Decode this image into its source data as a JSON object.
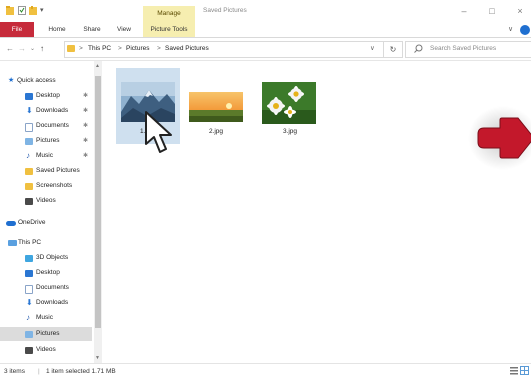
{
  "window": {
    "title": "Saved Pictures",
    "context_tab_group": "Manage",
    "minimize": "–",
    "maximize": "□",
    "close": "×"
  },
  "ribbon": {
    "tabs": [
      "File",
      "Home",
      "Share",
      "View",
      "Picture Tools"
    ],
    "collapse_glyph": "∨"
  },
  "nav": {
    "back": "←",
    "forward": "→",
    "recent": "⌄",
    "up": "↑",
    "breadcrumb": [
      "This PC",
      "Pictures",
      "Saved Pictures"
    ],
    "separator": ">",
    "dropdown": "∨",
    "refresh": "↻",
    "search_placeholder": "Search Saved Pictures"
  },
  "sidebar": {
    "quick_access": "Quick access",
    "quick_items": [
      {
        "label": "Desktop",
        "icon": "desktop-icon",
        "pinned": true
      },
      {
        "label": "Downloads",
        "icon": "download-icon",
        "pinned": true
      },
      {
        "label": "Documents",
        "icon": "documents-icon",
        "pinned": true
      },
      {
        "label": "Pictures",
        "icon": "pictures-icon",
        "pinned": true
      },
      {
        "label": "Music",
        "icon": "music-icon",
        "pinned": true
      },
      {
        "label": "Saved Pictures",
        "icon": "folder-icon",
        "pinned": false
      },
      {
        "label": "Screenshots",
        "icon": "folder-icon",
        "pinned": false
      },
      {
        "label": "Videos",
        "icon": "videos-icon",
        "pinned": false
      }
    ],
    "onedrive": "OneDrive",
    "this_pc": "This PC",
    "pc_items": [
      {
        "label": "3D Objects",
        "icon": "3d-objects-icon"
      },
      {
        "label": "Desktop",
        "icon": "desktop-icon"
      },
      {
        "label": "Documents",
        "icon": "documents-icon"
      },
      {
        "label": "Downloads",
        "icon": "download-icon"
      },
      {
        "label": "Music",
        "icon": "music-icon"
      },
      {
        "label": "Pictures",
        "icon": "pictures-icon",
        "selected": true
      },
      {
        "label": "Videos",
        "icon": "videos-icon"
      }
    ],
    "pin_glyph": "✱"
  },
  "files": [
    {
      "name": "1.jpg",
      "selected": true,
      "thumb": "mountain-photo"
    },
    {
      "name": "2.jpg",
      "selected": false,
      "thumb": "sunset-photo"
    },
    {
      "name": "3.jpg",
      "selected": false,
      "thumb": "daisy-photo"
    }
  ],
  "status": {
    "count": "3 items",
    "selection": "1 item selected  1.71 MB"
  },
  "colors": {
    "file_tab": "#c62b3b",
    "picture_tools": "#f6eeb0",
    "selection": "#cfe0ef",
    "arrow": "#c3182b"
  }
}
